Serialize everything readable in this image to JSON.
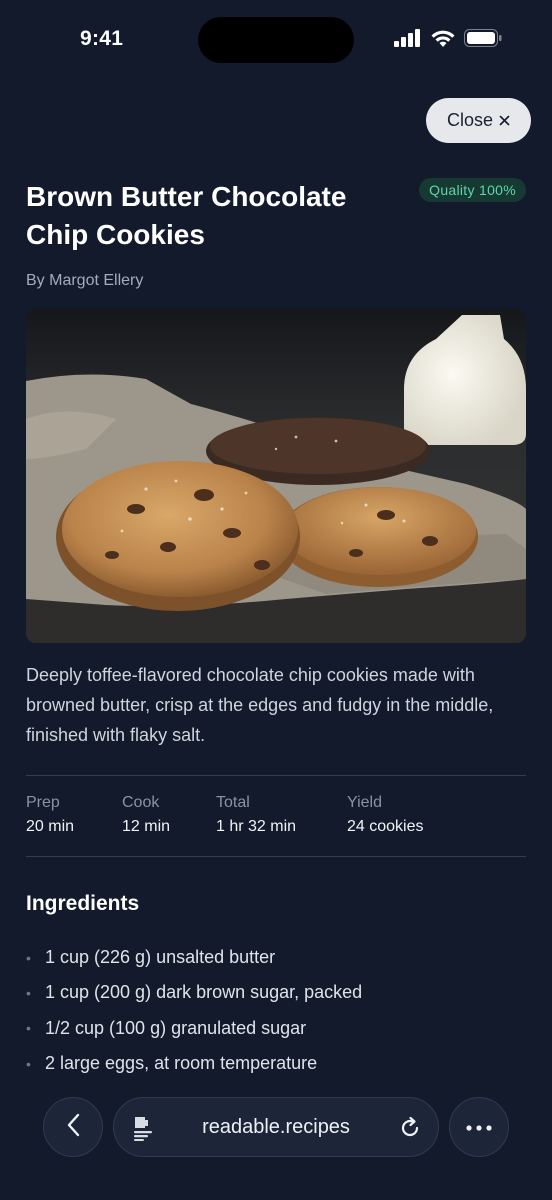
{
  "status_bar": {
    "time": "9:41",
    "icons": [
      "cellular-signal-icon",
      "wifi-icon",
      "battery-icon"
    ]
  },
  "close_button": {
    "label": "Close",
    "icon": "close-icon"
  },
  "recipe": {
    "title": "Brown Butter Chocolate Chip Cookies",
    "quality_badge": "Quality 100%",
    "author": "By Margot Ellery",
    "image_alt": "Chocolate chip cookies on a linen cloth with a bottle of milk",
    "description": "Deeply toffee-flavored chocolate chip cookies made with browned butter, crisp at the edges and fudgy in the middle, finished with flaky salt.",
    "meta": [
      {
        "label": "Prep",
        "value": "20 min"
      },
      {
        "label": "Cook",
        "value": "12 min"
      },
      {
        "label": "Total",
        "value": "1 hr 32 min"
      },
      {
        "label": "Yield",
        "value": "24 cookies"
      }
    ],
    "ingredients_heading": "Ingredients",
    "ingredients": [
      "1 cup (226 g) unsalted butter",
      "1 cup (200 g) dark brown sugar, packed",
      "1/2 cup (100 g) granulated sugar",
      "2 large eggs, at room temperature"
    ]
  },
  "toolbar": {
    "back_icon": "chevron-left-icon",
    "reader_icon": "reader-mode-icon",
    "url": "readable.recipes",
    "reload_icon": "reload-icon",
    "more_icon": "more-horizontal-icon"
  },
  "colors": {
    "background": "#131a2b",
    "badge_bg": "#163a33",
    "badge_text": "#5fd6a6",
    "close_bg": "#e6e8ec"
  }
}
